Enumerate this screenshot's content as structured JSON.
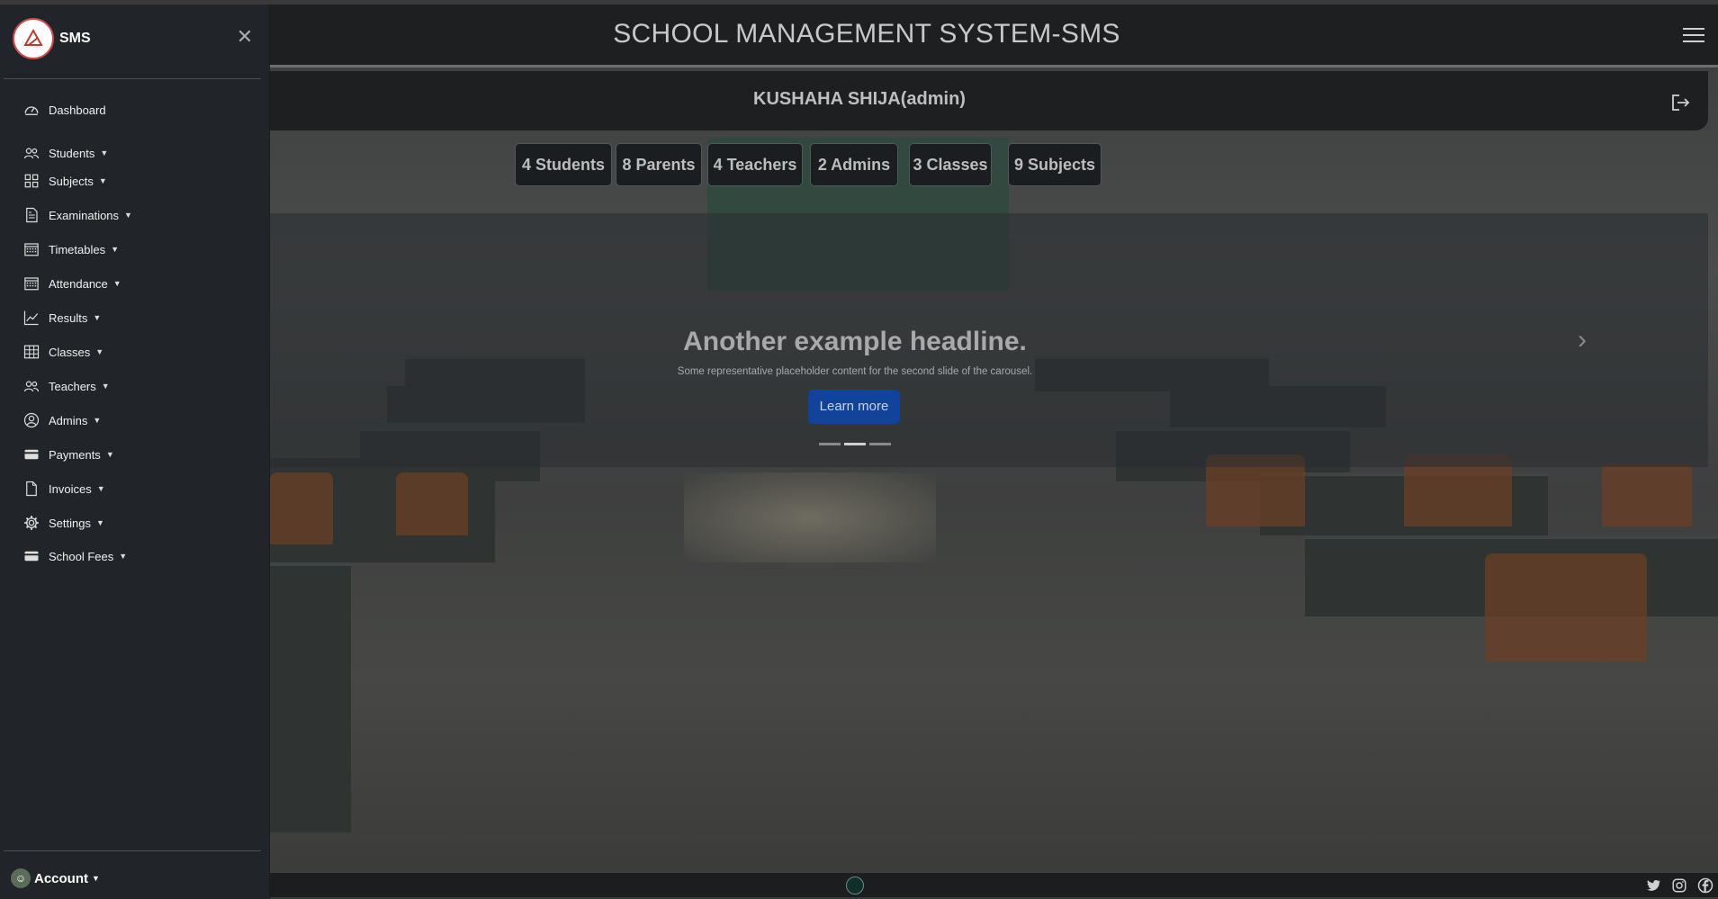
{
  "app": {
    "brand": "SMS",
    "title": "SCHOOL MANAGEMENT SYSTEM-SMS",
    "user": "KUSHAHA SHIJA(admin)"
  },
  "sidebar": {
    "items": [
      {
        "label": "Dashboard",
        "icon": "dashboard-gauge-icon",
        "caret": false
      },
      {
        "label": "Students",
        "icon": "people-icon",
        "caret": true
      },
      {
        "label": "Subjects",
        "icon": "grid-icon",
        "caret": true
      },
      {
        "label": "Examinations",
        "icon": "document-icon",
        "caret": true
      },
      {
        "label": "Timetables",
        "icon": "calendar-icon",
        "caret": true
      },
      {
        "label": "Attendance",
        "icon": "calendar-icon",
        "caret": true
      },
      {
        "label": "Results",
        "icon": "line-chart-icon",
        "caret": true
      },
      {
        "label": "Classes",
        "icon": "table-icon",
        "caret": true
      },
      {
        "label": "Teachers",
        "icon": "people-icon",
        "caret": true
      },
      {
        "label": "Admins",
        "icon": "person-circle-icon",
        "caret": true
      },
      {
        "label": "Payments",
        "icon": "credit-card-icon",
        "caret": true
      },
      {
        "label": "Invoices",
        "icon": "file-icon",
        "caret": true
      },
      {
        "label": "Settings",
        "icon": "gear-icon",
        "caret": true
      },
      {
        "label": "School Fees",
        "icon": "credit-card-icon",
        "caret": true
      }
    ],
    "account_label": "Account"
  },
  "stats": [
    "4 Students",
    "8 Parents",
    "4 Teachers",
    "2 Admins",
    "3 Classes",
    "9 Subjects"
  ],
  "carousel": {
    "headline": "Another example headline.",
    "text": "Some representative placeholder content for the second slide of the carousel.",
    "button": "Learn more",
    "active_index": 1,
    "slide_count": 3
  },
  "footer": {
    "social": [
      "twitter-icon",
      "instagram-icon",
      "facebook-icon"
    ]
  }
}
